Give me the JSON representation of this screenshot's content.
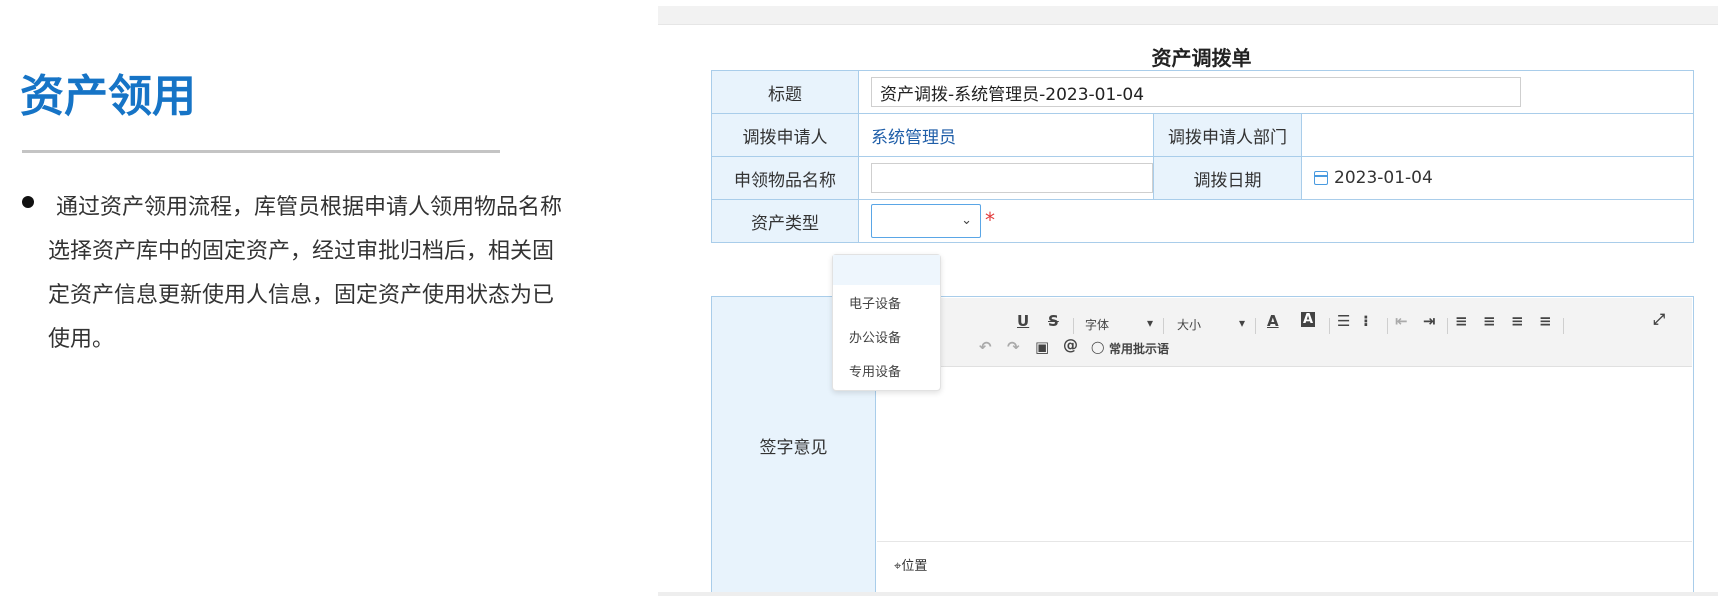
{
  "slide": {
    "title": "资产领用",
    "description": "通过资产领用流程，库管员根据申请人领用物品名称选择资产库中的固定资产，经过审批归档后，相关固定资产信息更新使用人信息，固定资产使用状态为已使用。"
  },
  "form": {
    "title": "资产调拨单",
    "rows": {
      "title_label": "标题",
      "title_value": "资产调拨-系统管理员-2023-01-04",
      "applicant_label": "调拨申请人",
      "applicant_value": "系统管理员",
      "dept_label": "调拨申请人部门",
      "item_label": "申领物品名称",
      "item_value": "",
      "date_label": "调拨日期",
      "date_value": "2023-01-04",
      "type_label": "资产类型",
      "type_value": ""
    },
    "required_mark": "*",
    "comment_label": "签字意见",
    "toolbar": {
      "underline": "U",
      "strike": "S",
      "font_label": "字体",
      "size_label": "大小",
      "font_color": "A",
      "bg_color": "A",
      "at": "@",
      "phrase": "常用批示语"
    },
    "location": "位置",
    "dropdown_options": [
      "电子设备",
      "办公设备",
      "专用设备"
    ]
  },
  "colors": {
    "title_blue": "#1674c6",
    "label_bg": "#e8f3fc",
    "border": "#a9cdea",
    "required": "#e23b3b",
    "link": "#1f5ea8"
  }
}
